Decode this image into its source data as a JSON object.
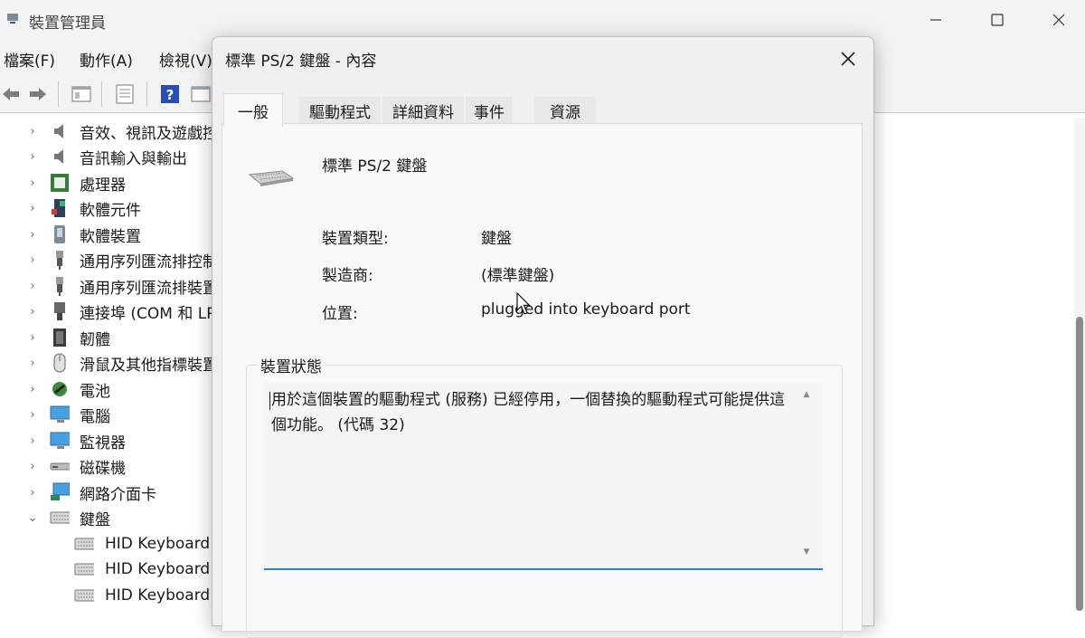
{
  "window": {
    "title": "裝置管理員"
  },
  "menu": [
    "檔案(F)",
    "動作(A)",
    "檢視(V)"
  ],
  "toolbar": {
    "buttons": [
      "back-arrow-icon",
      "forward-arrow-icon",
      "properties-pane-icon",
      "list-view-icon",
      "help-icon",
      "details-pane-icon"
    ]
  },
  "tree": {
    "items": [
      {
        "label": "音效、視訊及遊戲控制器",
        "icon": "speaker-icon",
        "expanded": false
      },
      {
        "label": "音訊輸入與輸出",
        "icon": "speaker-icon",
        "expanded": false
      },
      {
        "label": "處理器",
        "icon": "cpu-icon",
        "expanded": false
      },
      {
        "label": "軟體元件",
        "icon": "software-component-icon",
        "expanded": false
      },
      {
        "label": "軟體裝置",
        "icon": "software-device-icon",
        "expanded": false
      },
      {
        "label": "通用序列匯流排控制器",
        "icon": "usb-icon",
        "expanded": false
      },
      {
        "label": "通用序列匯流排裝置",
        "icon": "usb-icon",
        "expanded": false
      },
      {
        "label": "連接埠 (COM 和 LPT)",
        "icon": "port-icon",
        "expanded": false
      },
      {
        "label": "韌體",
        "icon": "firmware-icon",
        "expanded": false
      },
      {
        "label": "滑鼠及其他指標裝置",
        "icon": "mouse-icon",
        "expanded": false
      },
      {
        "label": "電池",
        "icon": "battery-icon",
        "expanded": false
      },
      {
        "label": "電腦",
        "icon": "computer-icon",
        "expanded": false
      },
      {
        "label": "監視器",
        "icon": "monitor-icon",
        "expanded": false
      },
      {
        "label": "磁碟機",
        "icon": "disk-drive-icon",
        "expanded": false
      },
      {
        "label": "網路介面卡",
        "icon": "network-adapter-icon",
        "expanded": false
      },
      {
        "label": "鍵盤",
        "icon": "keyboard-icon",
        "expanded": true
      }
    ],
    "keyboard_children": [
      "HID Keyboard Device",
      "HID Keyboard Device",
      "HID Keyboard Device"
    ]
  },
  "dialog": {
    "title": "標準 PS/2 鍵盤 - 內容",
    "tabs": [
      "一般",
      "驅動程式",
      "詳細資料",
      "事件",
      "資源"
    ],
    "active_tab": "一般",
    "device_name": "標準 PS/2 鍵盤",
    "properties": [
      {
        "label": "裝置類型:",
        "value": "鍵盤"
      },
      {
        "label": "製造商:",
        "value": "(標準鍵盤)"
      },
      {
        "label": "位置:",
        "value": "plugged into keyboard port"
      }
    ],
    "status_group_title": "裝置狀態",
    "status_text": "用於這個裝置的驅動程式 (服務) 已經停用，一個替換的驅動程式可能提供這個功能。 (代碼 32)"
  },
  "colors": {
    "accent": "#2f7fd1",
    "dialog_bg": "#f0f0f0",
    "panel_bg": "#f9f9f9"
  }
}
